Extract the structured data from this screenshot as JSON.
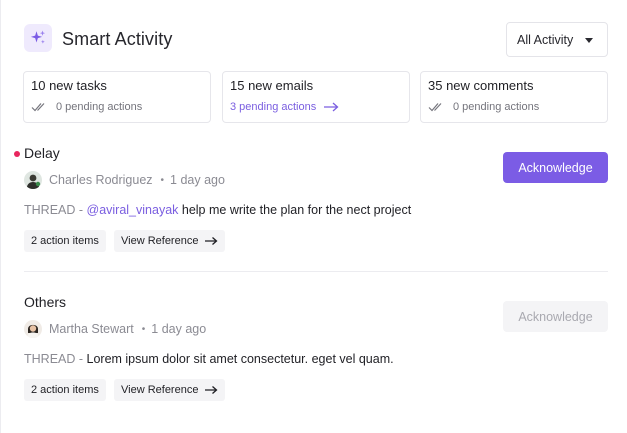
{
  "header": {
    "title": "Smart Activity",
    "filter_label": "All Activity",
    "logo_icon": "sparkles-icon"
  },
  "stats": [
    {
      "count_label": "10 new tasks",
      "pending_label": "0 pending actions",
      "icon": "double-check-icon"
    },
    {
      "count_label": "15 new emails",
      "pending_label": "3 pending actions",
      "icon": "arrow-right-icon"
    },
    {
      "count_label": "35 new comments",
      "pending_label": "0 pending actions",
      "icon": "double-check-icon"
    }
  ],
  "groups": [
    {
      "title": "Delay",
      "author": "Charles Rodriguez",
      "time": "1 day ago",
      "thread_tag": "THREAD - ",
      "mention": "@aviral_vinayak",
      "message": " help me write the plan for the nect project",
      "chip_actions": "2 action items",
      "chip_reference": "View Reference",
      "ack_label": "Acknowledge"
    },
    {
      "title": "Others",
      "author": "Martha Stewart",
      "time": "1 day ago",
      "thread_tag": "THREAD - ",
      "message": "Lorem ipsum dolor sit amet consectetur. eget vel quam.",
      "chip_actions": "2 action items",
      "chip_reference": "View Reference",
      "ack_label": "Acknowledge"
    }
  ],
  "colors": {
    "accent": "#7b5ce5",
    "unread_dot": "#e8265e",
    "link": "#7a5ee0"
  }
}
